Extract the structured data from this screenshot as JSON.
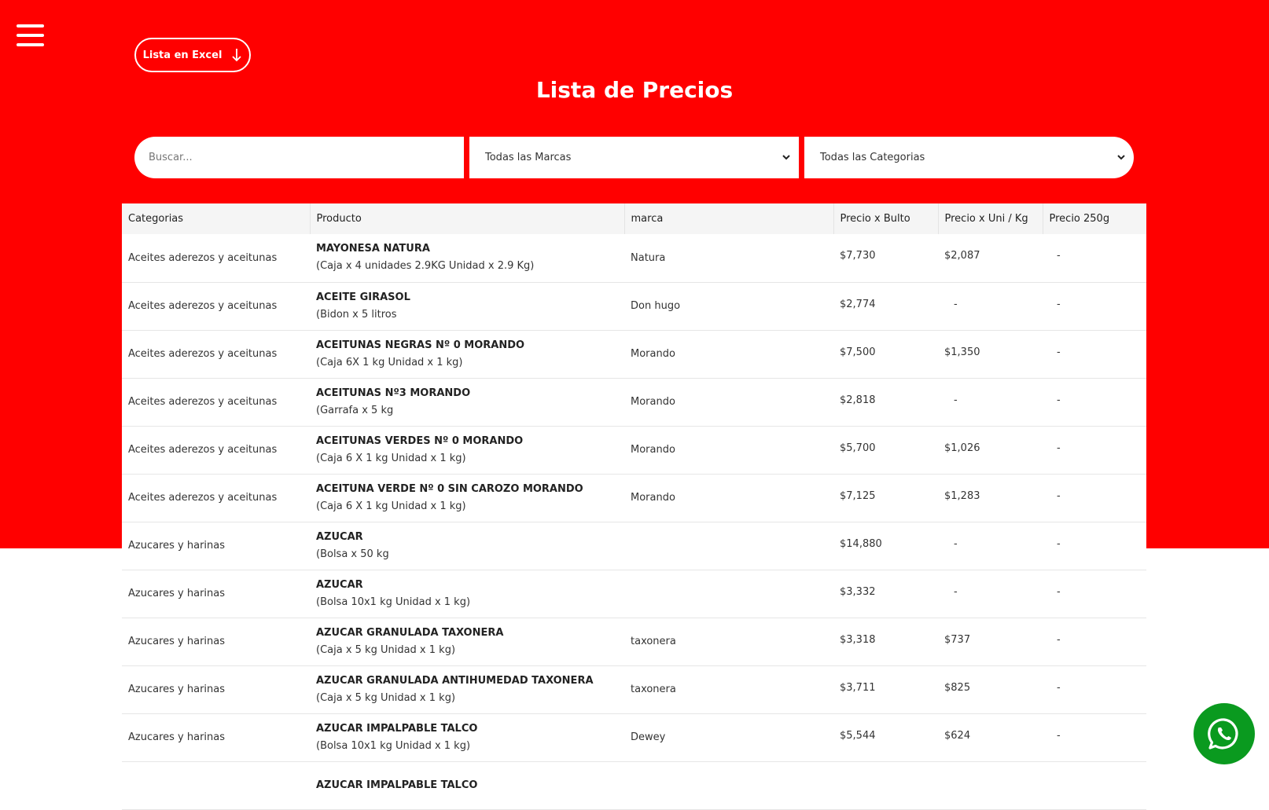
{
  "header": {
    "excel_button_label": "Lista en Excel",
    "title": "Lista de Precios"
  },
  "filters": {
    "search_placeholder": "Buscar...",
    "brand_selected": "Todas las Marcas",
    "category_selected": "Todas las Categorias"
  },
  "table": {
    "columns": [
      "Categorias",
      "Producto",
      "marca",
      "Precio x Bulto",
      "Precio x Uni / Kg",
      "Precio 250g"
    ],
    "rows": [
      {
        "categoria": "Aceites aderezos y aceitunas",
        "producto": "MAYONESA NATURA",
        "detalle": "(Caja x 4 unidades 2.9KG Unidad x 2.9 Kg)",
        "marca": "Natura",
        "bulto": "$7,730",
        "unidad": "$2,087",
        "g250": "-"
      },
      {
        "categoria": "Aceites aderezos y aceitunas",
        "producto": "ACEITE GIRASOL",
        "detalle": "(Bidon x 5 litros",
        "marca": "Don hugo",
        "bulto": "$2,774",
        "unidad": "-",
        "g250": "-"
      },
      {
        "categoria": "Aceites aderezos y aceitunas",
        "producto": "ACEITUNAS NEGRAS Nº 0 MORANDO",
        "detalle": "(Caja 6X 1 kg Unidad x 1 kg)",
        "marca": "Morando",
        "bulto": "$7,500",
        "unidad": "$1,350",
        "g250": "-"
      },
      {
        "categoria": "Aceites aderezos y aceitunas",
        "producto": "ACEITUNAS Nº3 MORANDO",
        "detalle": "(Garrafa x 5 kg",
        "marca": "Morando",
        "bulto": "$2,818",
        "unidad": "-",
        "g250": "-"
      },
      {
        "categoria": "Aceites aderezos y aceitunas",
        "producto": "ACEITUNAS VERDES Nº 0 MORANDO",
        "detalle": "(Caja 6 X 1 kg Unidad x 1 kg)",
        "marca": "Morando",
        "bulto": "$5,700",
        "unidad": "$1,026",
        "g250": "-"
      },
      {
        "categoria": "Aceites aderezos y aceitunas",
        "producto": "ACEITUNA VERDE Nº 0 SIN CAROZO MORANDO",
        "detalle": "(Caja 6 X 1 kg Unidad x 1 kg)",
        "marca": "Morando",
        "bulto": "$7,125",
        "unidad": "$1,283",
        "g250": "-"
      },
      {
        "categoria": "Azucares y harinas",
        "producto": "AZUCAR",
        "detalle": "(Bolsa x 50 kg",
        "marca": "",
        "bulto": "$14,880",
        "unidad": "-",
        "g250": "-"
      },
      {
        "categoria": "Azucares y harinas",
        "producto": "AZUCAR",
        "detalle": "(Bolsa 10x1 kg Unidad x 1 kg)",
        "marca": "",
        "bulto": "$3,332",
        "unidad": "-",
        "g250": "-"
      },
      {
        "categoria": "Azucares y harinas",
        "producto": "AZUCAR GRANULADA TAXONERA",
        "detalle": "(Caja x 5 kg Unidad x 1 kg)",
        "marca": "taxonera",
        "bulto": "$3,318",
        "unidad": "$737",
        "g250": "-"
      },
      {
        "categoria": "Azucares y harinas",
        "producto": "AZUCAR GRANULADA ANTIHUMEDAD TAXONERA",
        "detalle": "(Caja x 5 kg Unidad x 1 kg)",
        "marca": "taxonera",
        "bulto": "$3,711",
        "unidad": "$825",
        "g250": "-"
      },
      {
        "categoria": "Azucares y harinas",
        "producto": "AZUCAR IMPALPABLE TALCO",
        "detalle": "(Bolsa 10x1 kg Unidad x 1 kg)",
        "marca": "Dewey",
        "bulto": "$5,544",
        "unidad": "$624",
        "g250": "-"
      },
      {
        "categoria": "",
        "producto": "AZUCAR IMPALPABLE TALCO",
        "detalle": "",
        "marca": "",
        "bulto": "",
        "unidad": "",
        "g250": ""
      }
    ]
  },
  "icons": {
    "menu": "hamburger-menu-icon",
    "download": "arrow-down-icon",
    "dropdown": "chevron-down-icon",
    "whatsapp": "whatsapp-icon"
  },
  "colors": {
    "hero_red": "#ff0000",
    "whatsapp_green": "#0a9a1f"
  }
}
